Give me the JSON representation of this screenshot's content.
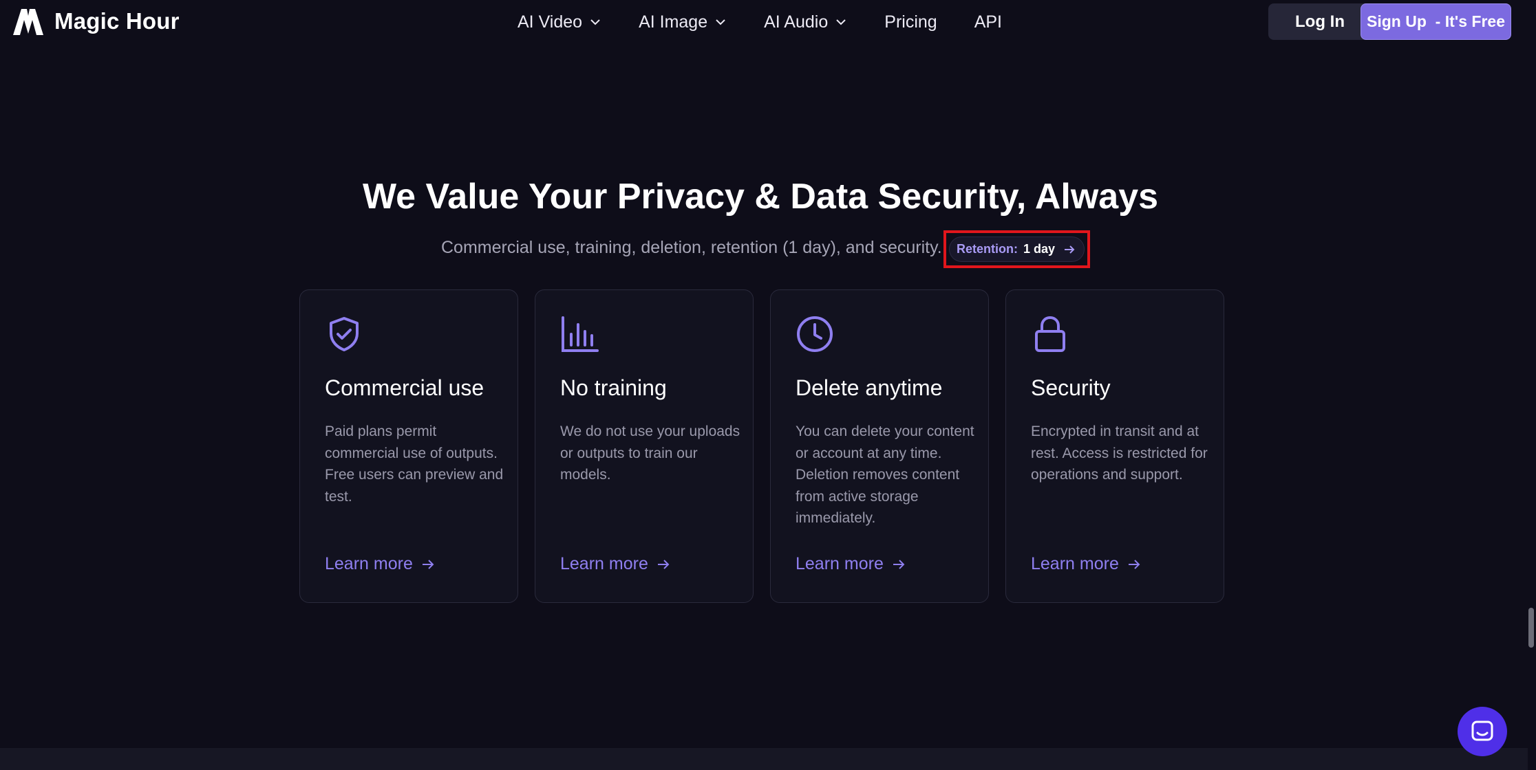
{
  "header": {
    "brand": "Magic Hour",
    "nav": [
      {
        "label": "AI Video",
        "has_dropdown": true,
        "icon": "chevron-down-icon"
      },
      {
        "label": "AI Image",
        "has_dropdown": true,
        "icon": "chevron-down-icon"
      },
      {
        "label": "AI Audio",
        "has_dropdown": true,
        "icon": "chevron-down-icon"
      },
      {
        "label": "Pricing",
        "has_dropdown": false
      },
      {
        "label": "API",
        "has_dropdown": false
      }
    ],
    "login_label": "Log In",
    "signup_label": "Sign Up  - It's Free"
  },
  "hero": {
    "title": "We Value Your Privacy & Data Security, Always",
    "subtitle": "Commercial use, training, deletion, retention (1 day), and security.",
    "retention_label": "Retention:",
    "retention_value": "1 day"
  },
  "cards": [
    {
      "icon": "shield-check-icon",
      "title": "Commercial use",
      "description": "Paid plans permit commercial use of outputs. Free users can preview and test.",
      "link": "Learn more"
    },
    {
      "icon": "bar-chart-icon",
      "title": "No training",
      "description": "We do not use your uploads or outputs to train our models.",
      "link": "Learn more"
    },
    {
      "icon": "clock-icon",
      "title": "Delete anytime",
      "description": "You can delete your content or account at any time. Deletion removes content from active storage immediately.",
      "link": "Learn more"
    },
    {
      "icon": "lock-icon",
      "title": "Security",
      "description": "Encrypted in transit and at rest. Access is restricted for operations and support.",
      "link": "Learn more"
    }
  ],
  "colors": {
    "background": "#0e0d19",
    "accent": "#8f7ff0",
    "signup_button": "#7c6ae0",
    "card_background": "#12121f",
    "highlight_box": "#e0161c",
    "chat_launcher": "#4f2fe8"
  }
}
